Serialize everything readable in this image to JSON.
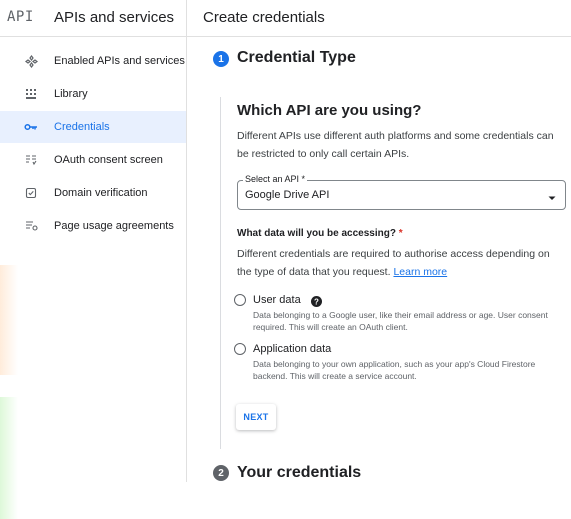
{
  "header": {
    "logo_text": "API",
    "product_title": "APIs and services",
    "page_title": "Create credentials"
  },
  "sidebar": {
    "items": [
      {
        "label": "Enabled APIs and services",
        "icon": "diamond-dots-icon",
        "active": false
      },
      {
        "label": "Library",
        "icon": "library-grid-icon",
        "active": false
      },
      {
        "label": "Credentials",
        "icon": "key-icon",
        "active": true
      },
      {
        "label": "OAuth consent screen",
        "icon": "consent-list-icon",
        "active": false
      },
      {
        "label": "Domain verification",
        "icon": "checkbox-icon",
        "active": false
      },
      {
        "label": "Page usage agreements",
        "icon": "settings-list-icon",
        "active": false
      }
    ]
  },
  "steps": [
    {
      "number": "1",
      "title": "Credential Type",
      "state": "active"
    },
    {
      "number": "2",
      "title": "Your credentials",
      "state": "inactive"
    }
  ],
  "api_section": {
    "heading": "Which API are you using?",
    "description": "Different APIs use different auth platforms and some credentials can be restricted to only call certain APIs.",
    "select": {
      "label": "Select an API *",
      "value": "Google Drive API"
    }
  },
  "data_section": {
    "question": "What data will you be accessing?",
    "required_mark": "*",
    "description": "Different credentials are required to authorise access depending on the type of data that you request.",
    "learn_more": "Learn more",
    "options": [
      {
        "title": "User data",
        "description": "Data belonging to a Google user, like their email address or age. User consent required. This will create an OAuth client.",
        "selected": false
      },
      {
        "title": "Application data",
        "description": "Data belonging to your own application, such as your app's Cloud Firestore backend. This will create a service account.",
        "selected": false
      }
    ]
  },
  "next_label": "NEXT",
  "colors": {
    "accent": "#1a73e8",
    "active_nav_bg": "#e8f0fe",
    "required": "#d93025"
  }
}
